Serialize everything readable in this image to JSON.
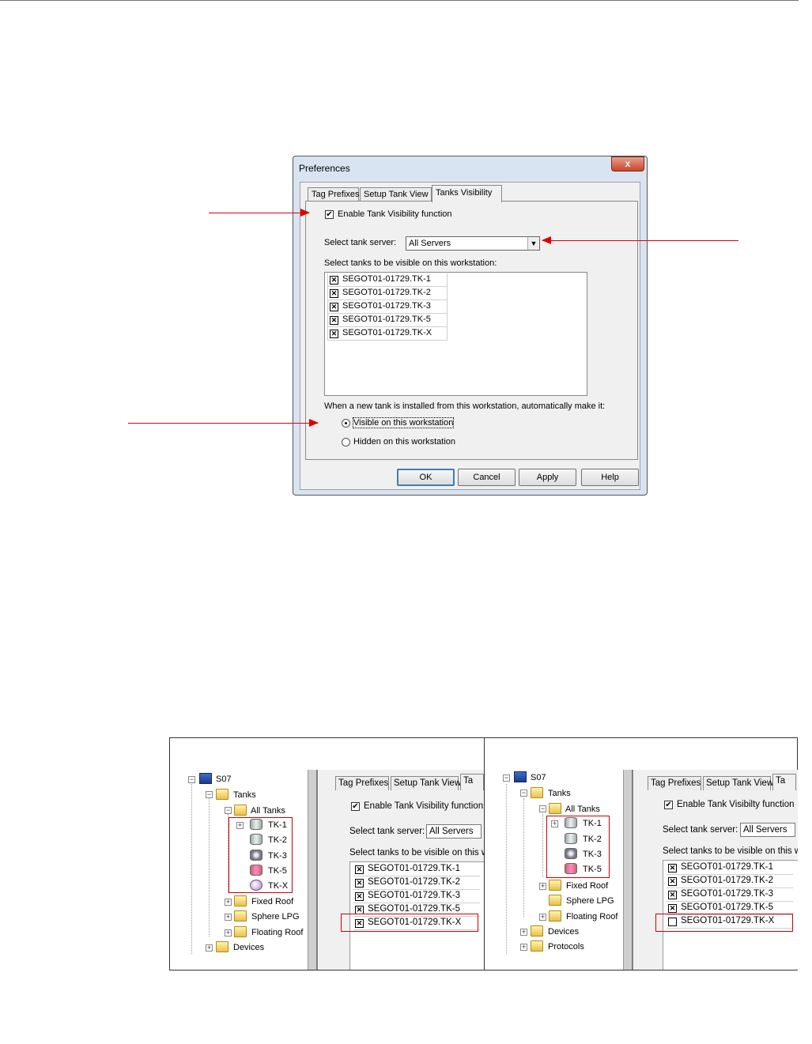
{
  "dialog": {
    "title": "Preferences",
    "close_glyph": "x",
    "tabs": [
      "Tag Prefixes",
      "Setup Tank View",
      "Tanks Visibility"
    ],
    "enable_label": "Enable Tank Visibility function",
    "server_label": "Select tank server:",
    "server_value": "All Servers",
    "tanks_label": "Select tanks to be visible on this workstation:",
    "tanks": [
      "SEGOT01-01729.TK-1",
      "SEGOT01-01729.TK-2",
      "SEGOT01-01729.TK-3",
      "SEGOT01-01729.TK-5",
      "SEGOT01-01729.TK-X"
    ],
    "new_tank_label": "When a new tank is installed from this workstation, automatically make it:",
    "radio_visible": "Visible on this workstation",
    "radio_hidden": "Hidden on this workstation",
    "buttons": {
      "ok": "OK",
      "cancel": "Cancel",
      "apply": "Apply",
      "help": "Help"
    }
  },
  "compare": {
    "left": {
      "tree": {
        "root": "S07",
        "tanks": "Tanks",
        "all_tanks": "All Tanks",
        "tank_items": [
          "TK-1",
          "TK-2",
          "TK-3",
          "TK-5",
          "TK-X"
        ],
        "folders": [
          "Fixed Roof",
          "Sphere LPG",
          "Floating Roof"
        ],
        "devices": "Devices"
      },
      "tabs": [
        "Tag Prefixes",
        "Setup Tank View",
        "Ta"
      ],
      "enable_label": "Enable Tank Visibility function",
      "server_label": "Select tank server:",
      "server_value": "All Servers",
      "tanks_label": "Select tanks to be visible on this w",
      "tanks": [
        "SEGOT01-01729.TK-1",
        "SEGOT01-01729.TK-2",
        "SEGOT01-01729.TK-3",
        "SEGOT01-01729.TK-5",
        "SEGOT01-01729.TK-X"
      ]
    },
    "right": {
      "tree": {
        "root": "S07",
        "tanks": "Tanks",
        "all_tanks": "All Tanks",
        "tank_items": [
          "TK-1",
          "TK-2",
          "TK-3",
          "TK-5"
        ],
        "folders": [
          "Fixed Roof",
          "Sphere LPG",
          "Floating Roof"
        ],
        "devices": "Devices",
        "protocols": "Protocols"
      },
      "tabs": [
        "Tag Prefixes",
        "Setup Tank View",
        "Ta"
      ],
      "enable_label": "Enable Tank Visibilty function",
      "server_label": "Select tank server:",
      "server_value": "All Servers",
      "tanks_label": "Select tanks to be visible on this w",
      "tanks": [
        "SEGOT01-01729.TK-1",
        "SEGOT01-01729.TK-2",
        "SEGOT01-01729.TK-3",
        "SEGOT01-01729.TK-5",
        "SEGOT01-01729.TK-X"
      ]
    }
  },
  "colors": {
    "annotation": "#e00000",
    "dialog_frame": "#d8e4f1"
  }
}
